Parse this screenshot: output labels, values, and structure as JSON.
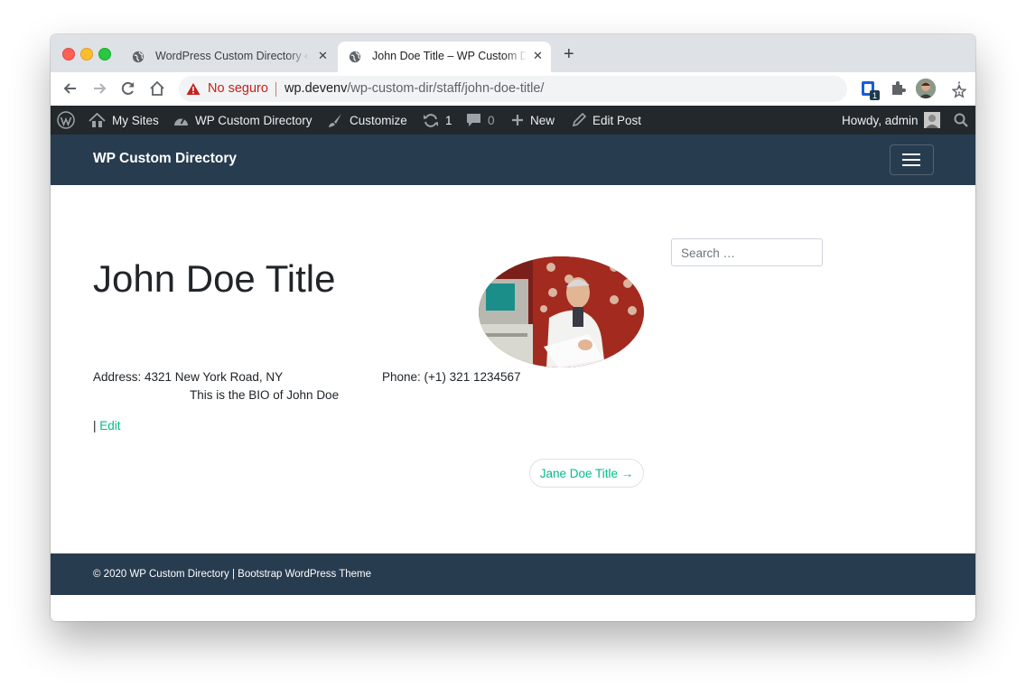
{
  "browser": {
    "tabs": [
      {
        "title": "WordPress Custom Directory ‹ WP Custom Directory",
        "active": false
      },
      {
        "title": "John Doe Title – WP Custom Directory",
        "active": true
      }
    ],
    "security_label": "No seguro",
    "url_host": "wp.devenv",
    "url_path": "/wp-custom-dir/staff/john-doe-title/",
    "extension_badge": "1"
  },
  "adminbar": {
    "my_sites": "My Sites",
    "site_name": "WP Custom Directory",
    "customize": "Customize",
    "updates_count": "1",
    "comments_count": "0",
    "new": "New",
    "edit_post": "Edit Post",
    "howdy": "Howdy, admin"
  },
  "site": {
    "brand": "WP Custom Directory"
  },
  "main": {
    "title": "John Doe Title",
    "address": "Address: 4321 New York Road, NY",
    "phone": "Phone: (+1) 321 1234567",
    "bio": "This is the BIO of John Doe",
    "edit_prefix": "|",
    "edit_label": "Edit",
    "next_post": "Jane Doe Title →",
    "search_placeholder": "Search …"
  },
  "footer": {
    "text": "© 2020 WP Custom Directory | Bootstrap WordPress Theme"
  },
  "colors": {
    "admin_bar": "#23282d",
    "site_header": "#283c50",
    "accent": "#00bc8c",
    "insecure": "#c5221f"
  },
  "icons": [
    "globe-icon",
    "close-icon",
    "plus-icon",
    "back-arrow-icon",
    "forward-arrow-icon",
    "reload-icon",
    "home-icon",
    "warning-icon",
    "star-icon",
    "puzzle-icon",
    "wordpress-logo-icon",
    "dashboard-icon",
    "brush-icon",
    "updates-icon",
    "comment-icon",
    "pencil-icon",
    "search-icon",
    "hamburger-icon"
  ]
}
